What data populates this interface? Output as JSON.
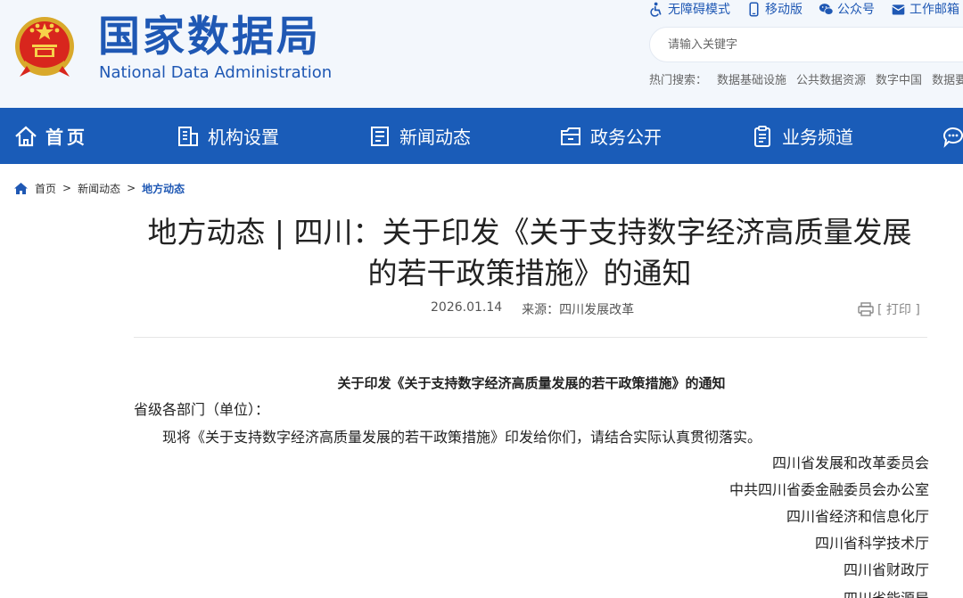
{
  "header": {
    "title_cn": "国家数据局",
    "title_en": "National Data Administration",
    "top_links": [
      {
        "label": "无障碍模式",
        "icon": "accessibility-icon"
      },
      {
        "label": "移动版",
        "icon": "mobile-icon"
      },
      {
        "label": "公众号",
        "icon": "wechat-icon"
      },
      {
        "label": "工作邮箱",
        "icon": "mail-icon"
      }
    ],
    "search": {
      "placeholder": "请输入关键字"
    },
    "hot_search": {
      "label": "热门搜索：",
      "terms": [
        "数据基础设施",
        "公共数据资源",
        "数字中国",
        "数据要素"
      ]
    }
  },
  "nav": {
    "items": [
      {
        "label": "首页",
        "icon": "home-icon"
      },
      {
        "label": "机构设置",
        "icon": "building-icon"
      },
      {
        "label": "新闻动态",
        "icon": "news-icon"
      },
      {
        "label": "政务公开",
        "icon": "folder-icon"
      },
      {
        "label": "业务频道",
        "icon": "clipboard-icon"
      },
      {
        "label": "",
        "icon": "chat-icon"
      }
    ]
  },
  "breadcrumb": {
    "items": [
      "首页",
      "新闻动态",
      "地方动态"
    ],
    "separator": ">"
  },
  "article": {
    "title_line1": "地方动态 | 四川：关于印发《关于支持数字经济高质量发展",
    "title_line2": "的若干政策措施》的通知",
    "date": "2026.01.14",
    "source": "来源：四川发展改革",
    "print_label": "[ 打印 ]",
    "doc_title": "关于印发《关于支持数字经济高质量发展的若干政策措施》的通知",
    "salutation": "省级各部门（单位）：",
    "body": "现将《关于支持数字经济高质量发展的若干政策措施》印发给你们，请结合实际认真贯彻落实。",
    "signatories": [
      "四川省发展和改革委员会",
      "中共四川省委金融委员会办公室",
      "四川省经济和信息化厅",
      "四川省科学技术厅",
      "四川省财政厅",
      "四川省能源局"
    ]
  },
  "colors": {
    "brand": "#1f58b4",
    "nav_bg": "#1a5cb8",
    "header_bg": "#f3f7fc"
  }
}
